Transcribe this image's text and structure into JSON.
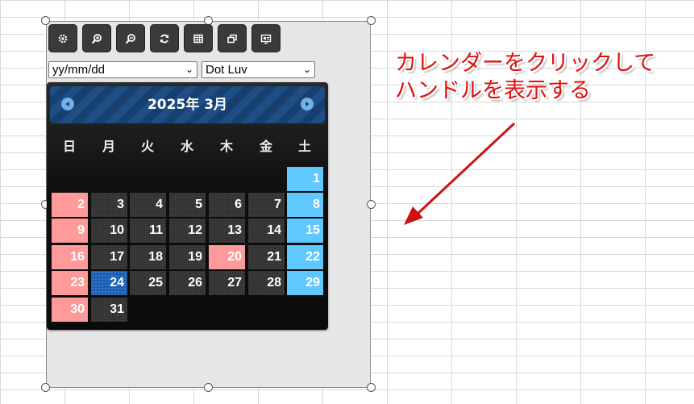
{
  "toolbar": {
    "buttons": [
      {
        "icon": "gear-icon"
      },
      {
        "icon": "zoom-in-icon"
      },
      {
        "icon": "zoom-out-icon"
      },
      {
        "icon": "refresh-icon"
      },
      {
        "icon": "grid-icon"
      },
      {
        "icon": "copy-window-icon"
      },
      {
        "icon": "image-export-icon"
      }
    ]
  },
  "selects": {
    "date_format": "yy/mm/dd",
    "theme": "Dot Luv"
  },
  "calendar": {
    "title": "2025年 3月",
    "weekdays": [
      "日",
      "月",
      "火",
      "水",
      "木",
      "金",
      "土"
    ],
    "today": "24"
  },
  "annotation": {
    "line1": "カレンダーをクリックして",
    "line2": "ハンドルを表示する"
  },
  "colors": {
    "annotation_red": "#e01010",
    "holiday": "#ff9a9a",
    "saturday": "#5ec8ff",
    "today": "#1c5fb0"
  }
}
